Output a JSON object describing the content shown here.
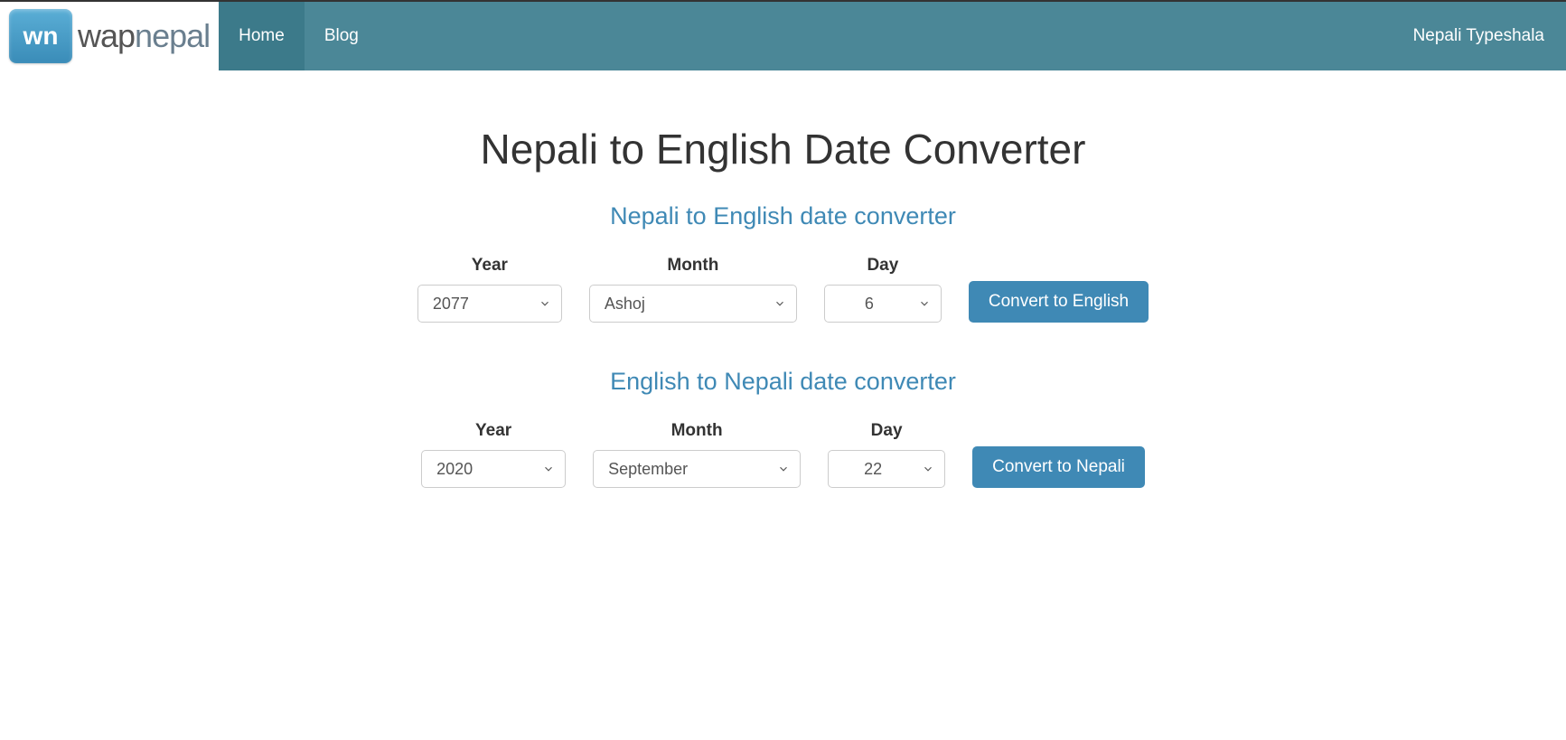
{
  "navbar": {
    "logo_icon_text": "wn",
    "logo_wap": "wap",
    "logo_nepal": "nepal",
    "items": [
      {
        "label": "Home",
        "active": true
      },
      {
        "label": "Blog",
        "active": false
      }
    ],
    "right_link": "Nepali Typeshala"
  },
  "page_title": "Nepali to English Date Converter",
  "sections": {
    "nepali_to_english": {
      "title": "Nepali to English date converter",
      "year_label": "Year",
      "month_label": "Month",
      "day_label": "Day",
      "year_value": "2077",
      "month_value": "Ashoj",
      "day_value": "6",
      "button_label": "Convert to English"
    },
    "english_to_nepali": {
      "title": "English to Nepali date converter",
      "year_label": "Year",
      "month_label": "Month",
      "day_label": "Day",
      "year_value": "2020",
      "month_value": "September",
      "day_value": "22",
      "button_label": "Convert to Nepali"
    }
  }
}
